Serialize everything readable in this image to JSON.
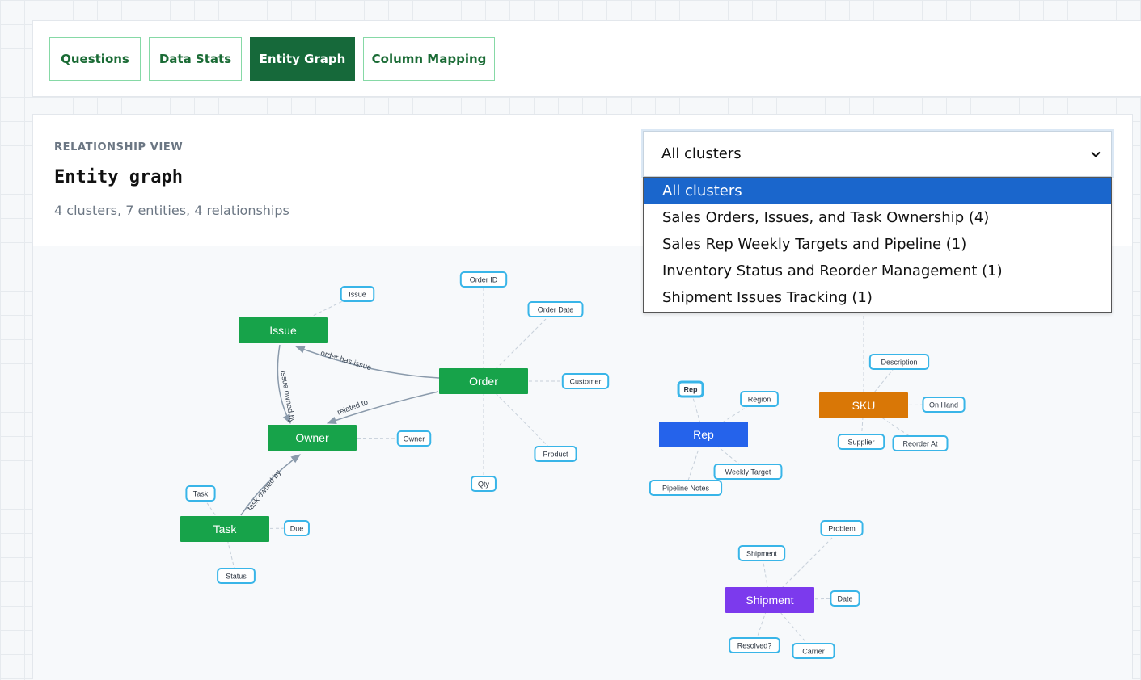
{
  "tabs": [
    {
      "label": "Questions",
      "active": false
    },
    {
      "label": "Data Stats",
      "active": false
    },
    {
      "label": "Entity Graph",
      "active": true
    },
    {
      "label": "Column Mapping",
      "active": false
    }
  ],
  "header": {
    "eyebrow": "RELATIONSHIP VIEW",
    "title": "Entity graph",
    "summary": "4 clusters, 7 entities, 4 relationships"
  },
  "cluster_select": {
    "value": "All clusters",
    "icon": "chevron-down-icon",
    "options": [
      "All clusters",
      "Sales Orders, Issues, and Task Ownership (4)",
      "Sales Rep Weekly Targets and Pipeline (1)",
      "Inventory Status and Reorder Management (1)",
      "Shipment Issues Tracking (1)"
    ]
  },
  "colors": {
    "cluster_sales": "#17a34a",
    "cluster_rep": "#2563eb",
    "cluster_inventory": "#d97706",
    "cluster_shipment": "#7c3aed",
    "attribute_border": "#39b5e8",
    "active_tab": "#16693a",
    "selected_option": "#1a66cc"
  },
  "graph": {
    "entities": [
      {
        "id": "issue",
        "label": "Issue",
        "cluster": "sales"
      },
      {
        "id": "order",
        "label": "Order",
        "cluster": "sales"
      },
      {
        "id": "owner",
        "label": "Owner",
        "cluster": "sales"
      },
      {
        "id": "task",
        "label": "Task",
        "cluster": "sales"
      },
      {
        "id": "rep",
        "label": "Rep",
        "cluster": "rep"
      },
      {
        "id": "sku",
        "label": "SKU",
        "cluster": "inventory"
      },
      {
        "id": "shipment",
        "label": "Shipment",
        "cluster": "shipment"
      }
    ],
    "attributes": [
      {
        "entity": "issue",
        "label": "Issue"
      },
      {
        "entity": "order",
        "label": "Order ID"
      },
      {
        "entity": "order",
        "label": "Order Date"
      },
      {
        "entity": "order",
        "label": "Customer"
      },
      {
        "entity": "order",
        "label": "Product"
      },
      {
        "entity": "order",
        "label": "Qty"
      },
      {
        "entity": "owner",
        "label": "Owner"
      },
      {
        "entity": "task",
        "label": "Task"
      },
      {
        "entity": "task",
        "label": "Due"
      },
      {
        "entity": "task",
        "label": "Status"
      },
      {
        "entity": "rep",
        "label": "Rep"
      },
      {
        "entity": "rep",
        "label": "Region"
      },
      {
        "entity": "rep",
        "label": "Weekly Target"
      },
      {
        "entity": "rep",
        "label": "Pipeline Notes"
      },
      {
        "entity": "sku",
        "label": "Description"
      },
      {
        "entity": "sku",
        "label": "On Hand"
      },
      {
        "entity": "sku",
        "label": "Supplier"
      },
      {
        "entity": "sku",
        "label": "Reorder At"
      },
      {
        "entity": "shipment",
        "label": "Shipment"
      },
      {
        "entity": "shipment",
        "label": "Problem"
      },
      {
        "entity": "shipment",
        "label": "Date"
      },
      {
        "entity": "shipment",
        "label": "Resolved?"
      },
      {
        "entity": "shipment",
        "label": "Carrier"
      }
    ],
    "relationships": [
      {
        "from": "order",
        "to": "issue",
        "label": "order has issue"
      },
      {
        "from": "order",
        "to": "owner",
        "label": "related to"
      },
      {
        "from": "issue",
        "to": "owner",
        "label": "issue owned by"
      },
      {
        "from": "task",
        "to": "owner",
        "label": "task owned by"
      }
    ]
  }
}
